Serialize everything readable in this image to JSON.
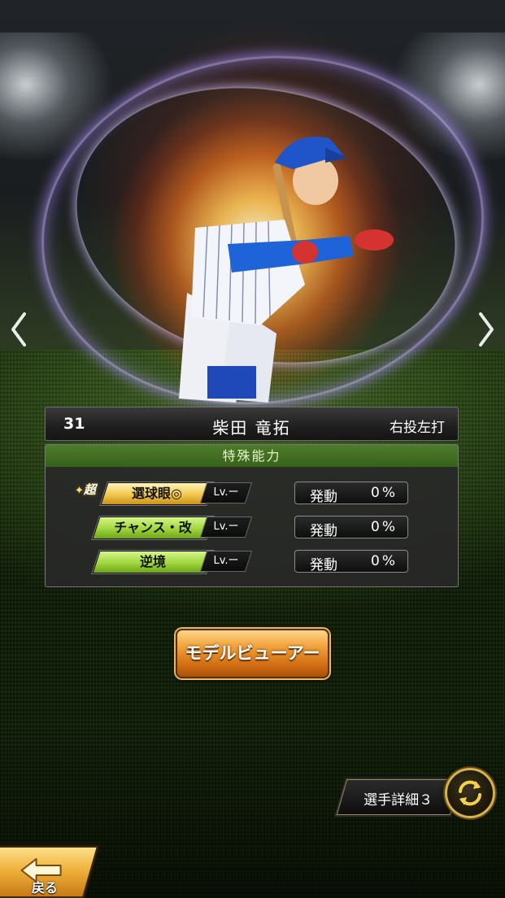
{
  "nav": {
    "prev_icon": "chevron-left-icon",
    "next_icon": "chevron-right-icon"
  },
  "player": {
    "number": "31",
    "name": "柴田 竜拓",
    "handedness": "右投左打"
  },
  "abilities": {
    "header": "特殊能力",
    "items": [
      {
        "prefix": "超",
        "name": "選球眼◎",
        "level": "Lv.ー",
        "activation_label": "発動",
        "activation_value": "0%",
        "tier": "gold"
      },
      {
        "prefix": "",
        "name": "チャンス・改",
        "level": "Lv.ー",
        "activation_label": "発動",
        "activation_value": "0%",
        "tier": "green"
      },
      {
        "prefix": "",
        "name": "逆境",
        "level": "Lv.ー",
        "activation_label": "発動",
        "activation_value": "0%",
        "tier": "green"
      }
    ]
  },
  "buttons": {
    "model_viewer": "モデルビューアー",
    "player_detail": "選手詳細３",
    "back": "戻る"
  },
  "colors": {
    "panel_header": "#37621a",
    "gold_tag": "#f2c74c",
    "green_tag": "#9fd63c",
    "button_orange": "#e88a2a"
  }
}
